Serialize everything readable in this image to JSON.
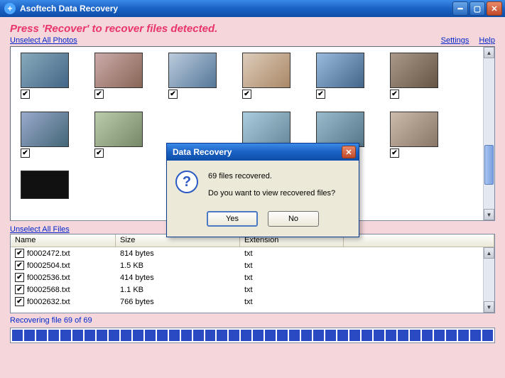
{
  "window": {
    "title": "Asoftech Data Recovery"
  },
  "instruction": "Press 'Recover' to recover files detected.",
  "links": {
    "unselect_photos": "Unselect All Photos",
    "unselect_files": "Unselect All Files",
    "settings": "Settings",
    "help": "Help"
  },
  "file_table": {
    "headers": {
      "name": "Name",
      "size": "Size",
      "ext": "Extension"
    },
    "rows": [
      {
        "name": "f0002472.txt",
        "size": "814 bytes",
        "ext": "txt"
      },
      {
        "name": "f0002504.txt",
        "size": "1.5 KB",
        "ext": "txt"
      },
      {
        "name": "f0002536.txt",
        "size": "414 bytes",
        "ext": "txt"
      },
      {
        "name": "f0002568.txt",
        "size": "1.1 KB",
        "ext": "txt"
      },
      {
        "name": "f0002632.txt",
        "size": "766 bytes",
        "ext": "txt"
      }
    ]
  },
  "status": "Recovering file 69 of 69",
  "dialog": {
    "title": "Data Recovery",
    "line1": "69 files recovered.",
    "line2": "Do you want to view recovered files?",
    "yes": "Yes",
    "no": "No"
  }
}
